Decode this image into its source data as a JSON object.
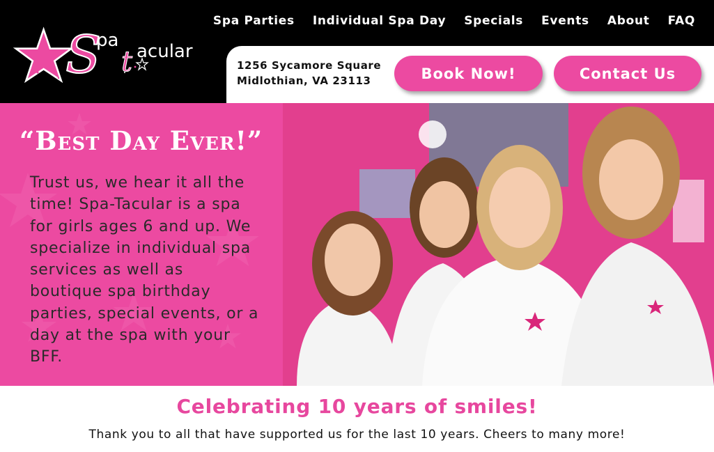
{
  "brand": {
    "logo_lettering": "Spatacular",
    "pink": "#ec4aa1",
    "black": "#000000"
  },
  "nav": {
    "items": [
      "Spa Parties",
      "Individual Spa Day",
      "Specials",
      "Events",
      "About",
      "FAQ"
    ]
  },
  "address": {
    "line1": "1256 Sycamore Square",
    "line2": "Midlothian, VA 23113"
  },
  "actions": {
    "book_label": "Book Now!",
    "contact_label": "Contact Us"
  },
  "hero": {
    "heading": "“Best Day Ever!”",
    "body": "Trust us, we hear it all the time! Spa-Tacular is a spa for girls ages 6 and up. We specialize in individual spa services as well as boutique spa birthday parties, special events, or a day at the spa with your BFF.",
    "photo_icon": "girls-in-spa-robes-photo"
  },
  "celebration": {
    "title": "Celebrating 10 years of smiles!",
    "message": "Thank you to all that have supported us for the last 10 years. Cheers to many more!"
  }
}
